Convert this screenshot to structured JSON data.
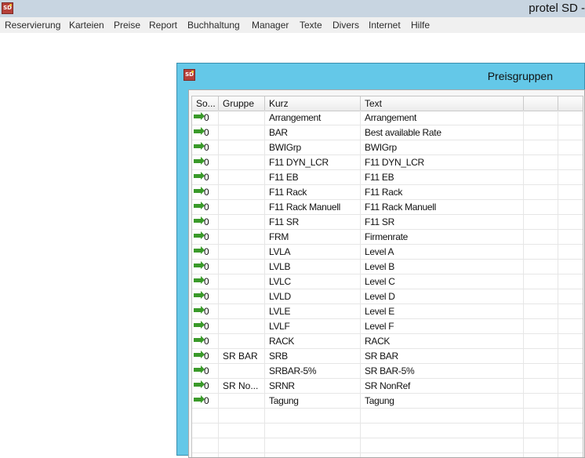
{
  "app": {
    "title": "protel SD -",
    "icon_label": "SD"
  },
  "menu": [
    "Reservierung",
    "Karteien",
    "Preise",
    "Report",
    "Buchhaltung",
    "Manager",
    "Texte",
    "Divers",
    "Internet",
    "Hilfe"
  ],
  "dialog": {
    "title": "Preisgruppen",
    "icon_label": "SD",
    "columns": [
      "So...",
      "Gruppe",
      "Kurz",
      "Text"
    ],
    "rows": [
      {
        "sort": "0",
        "gruppe": "",
        "kurz": "Arrangement",
        "text": "Arrangement"
      },
      {
        "sort": "0",
        "gruppe": "",
        "kurz": "BAR",
        "text": "Best available Rate"
      },
      {
        "sort": "0",
        "gruppe": "",
        "kurz": "BWIGrp",
        "text": "BWIGrp"
      },
      {
        "sort": "0",
        "gruppe": "",
        "kurz": "F11 DYN_LCR",
        "text": "F11 DYN_LCR"
      },
      {
        "sort": "0",
        "gruppe": "",
        "kurz": "F11 EB",
        "text": "F11 EB"
      },
      {
        "sort": "0",
        "gruppe": "",
        "kurz": "F11 Rack",
        "text": "F11 Rack"
      },
      {
        "sort": "0",
        "gruppe": "",
        "kurz": "F11 Rack Manuell",
        "text": "F11 Rack Manuell"
      },
      {
        "sort": "0",
        "gruppe": "",
        "kurz": "F11 SR",
        "text": "F11 SR"
      },
      {
        "sort": "0",
        "gruppe": "",
        "kurz": "FRM",
        "text": "Firmenrate"
      },
      {
        "sort": "0",
        "gruppe": "",
        "kurz": "LVLA",
        "text": "Level A"
      },
      {
        "sort": "0",
        "gruppe": "",
        "kurz": "LVLB",
        "text": "Level B"
      },
      {
        "sort": "0",
        "gruppe": "",
        "kurz": "LVLC",
        "text": "Level C"
      },
      {
        "sort": "0",
        "gruppe": "",
        "kurz": "LVLD",
        "text": "Level D"
      },
      {
        "sort": "0",
        "gruppe": "",
        "kurz": "LVLE",
        "text": "Level E"
      },
      {
        "sort": "0",
        "gruppe": "",
        "kurz": "LVLF",
        "text": "Level F"
      },
      {
        "sort": "0",
        "gruppe": "",
        "kurz": "RACK",
        "text": "RACK"
      },
      {
        "sort": "0",
        "gruppe": "SR BAR",
        "kurz": "SRB",
        "text": "SR BAR"
      },
      {
        "sort": "0",
        "gruppe": "",
        "kurz": "SRBAR-5%",
        "text": "SR BAR-5%"
      },
      {
        "sort": "0",
        "gruppe": "SR No...",
        "kurz": "SRNR",
        "text": "SR NonRef"
      },
      {
        "sort": "0",
        "gruppe": "",
        "kurz": "Tagung",
        "text": "Tagung"
      }
    ],
    "row_icon": "green-arrow-icon",
    "colors": {
      "dialog_bg": "#64c8e8",
      "arrow": "#3a9a2a",
      "titlebar": "#c8d5e1"
    }
  }
}
